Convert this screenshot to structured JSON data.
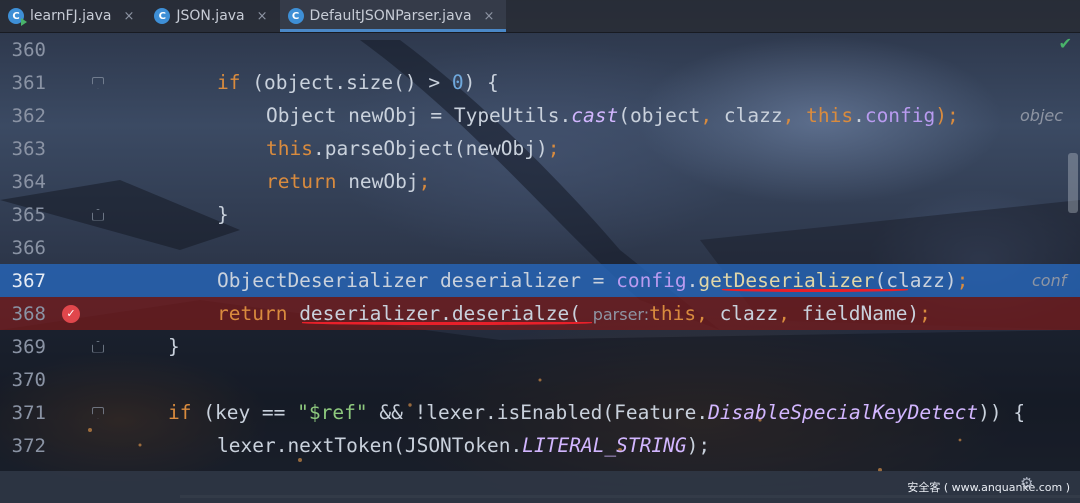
{
  "tabs": [
    {
      "label": "learnFJ.java",
      "icon": "java-class-runnable-icon",
      "active": false
    },
    {
      "label": "JSON.java",
      "icon": "java-class-icon",
      "active": false
    },
    {
      "label": "DefaultJSONParser.java",
      "icon": "java-class-icon",
      "active": true
    }
  ],
  "close_glyph": "×",
  "check_glyph": "✔",
  "lines": [
    {
      "num": "360"
    },
    {
      "num": "361",
      "t": [
        "if",
        " (object.size() > ",
        "0",
        ") {"
      ]
    },
    {
      "num": "362",
      "t": [
        "Object newObj = TypeUtils.",
        "cast",
        "(object",
        ",",
        " clazz",
        ",",
        " ",
        "this",
        ".",
        "config",
        ");",
        "objec"
      ]
    },
    {
      "num": "363",
      "t": [
        "this",
        ".parseObject(newObj)",
        ";"
      ]
    },
    {
      "num": "364",
      "t": [
        "return",
        " newObj",
        ";"
      ]
    },
    {
      "num": "365",
      "t": [
        "}"
      ]
    },
    {
      "num": "366"
    },
    {
      "num": "367",
      "t": [
        "ObjectDeserializer deserializer = ",
        "config",
        ".",
        "getDeserializer",
        "(clazz)",
        ";",
        "conf"
      ]
    },
    {
      "num": "368",
      "t": [
        "return",
        " deserializer.deserialze(",
        "parser:",
        "this",
        ",",
        " clazz",
        ",",
        " fieldName)",
        ";"
      ]
    },
    {
      "num": "369",
      "t": [
        "}"
      ]
    },
    {
      "num": "370"
    },
    {
      "num": "371",
      "t": [
        "if",
        " (key == ",
        "\"$ref\"",
        " && !lexer.isEnabled(Feature.",
        "DisableSpecialKeyDetect",
        ")) {"
      ]
    },
    {
      "num": "372",
      "t": [
        "lexer.nextToken(JSONToken.",
        "LITERAL_STRING",
        ");"
      ]
    }
  ],
  "breakpoint_glyph": "✓",
  "gear_glyph": "⚙",
  "watermark": "安全客 ( www.anquanke.com )"
}
